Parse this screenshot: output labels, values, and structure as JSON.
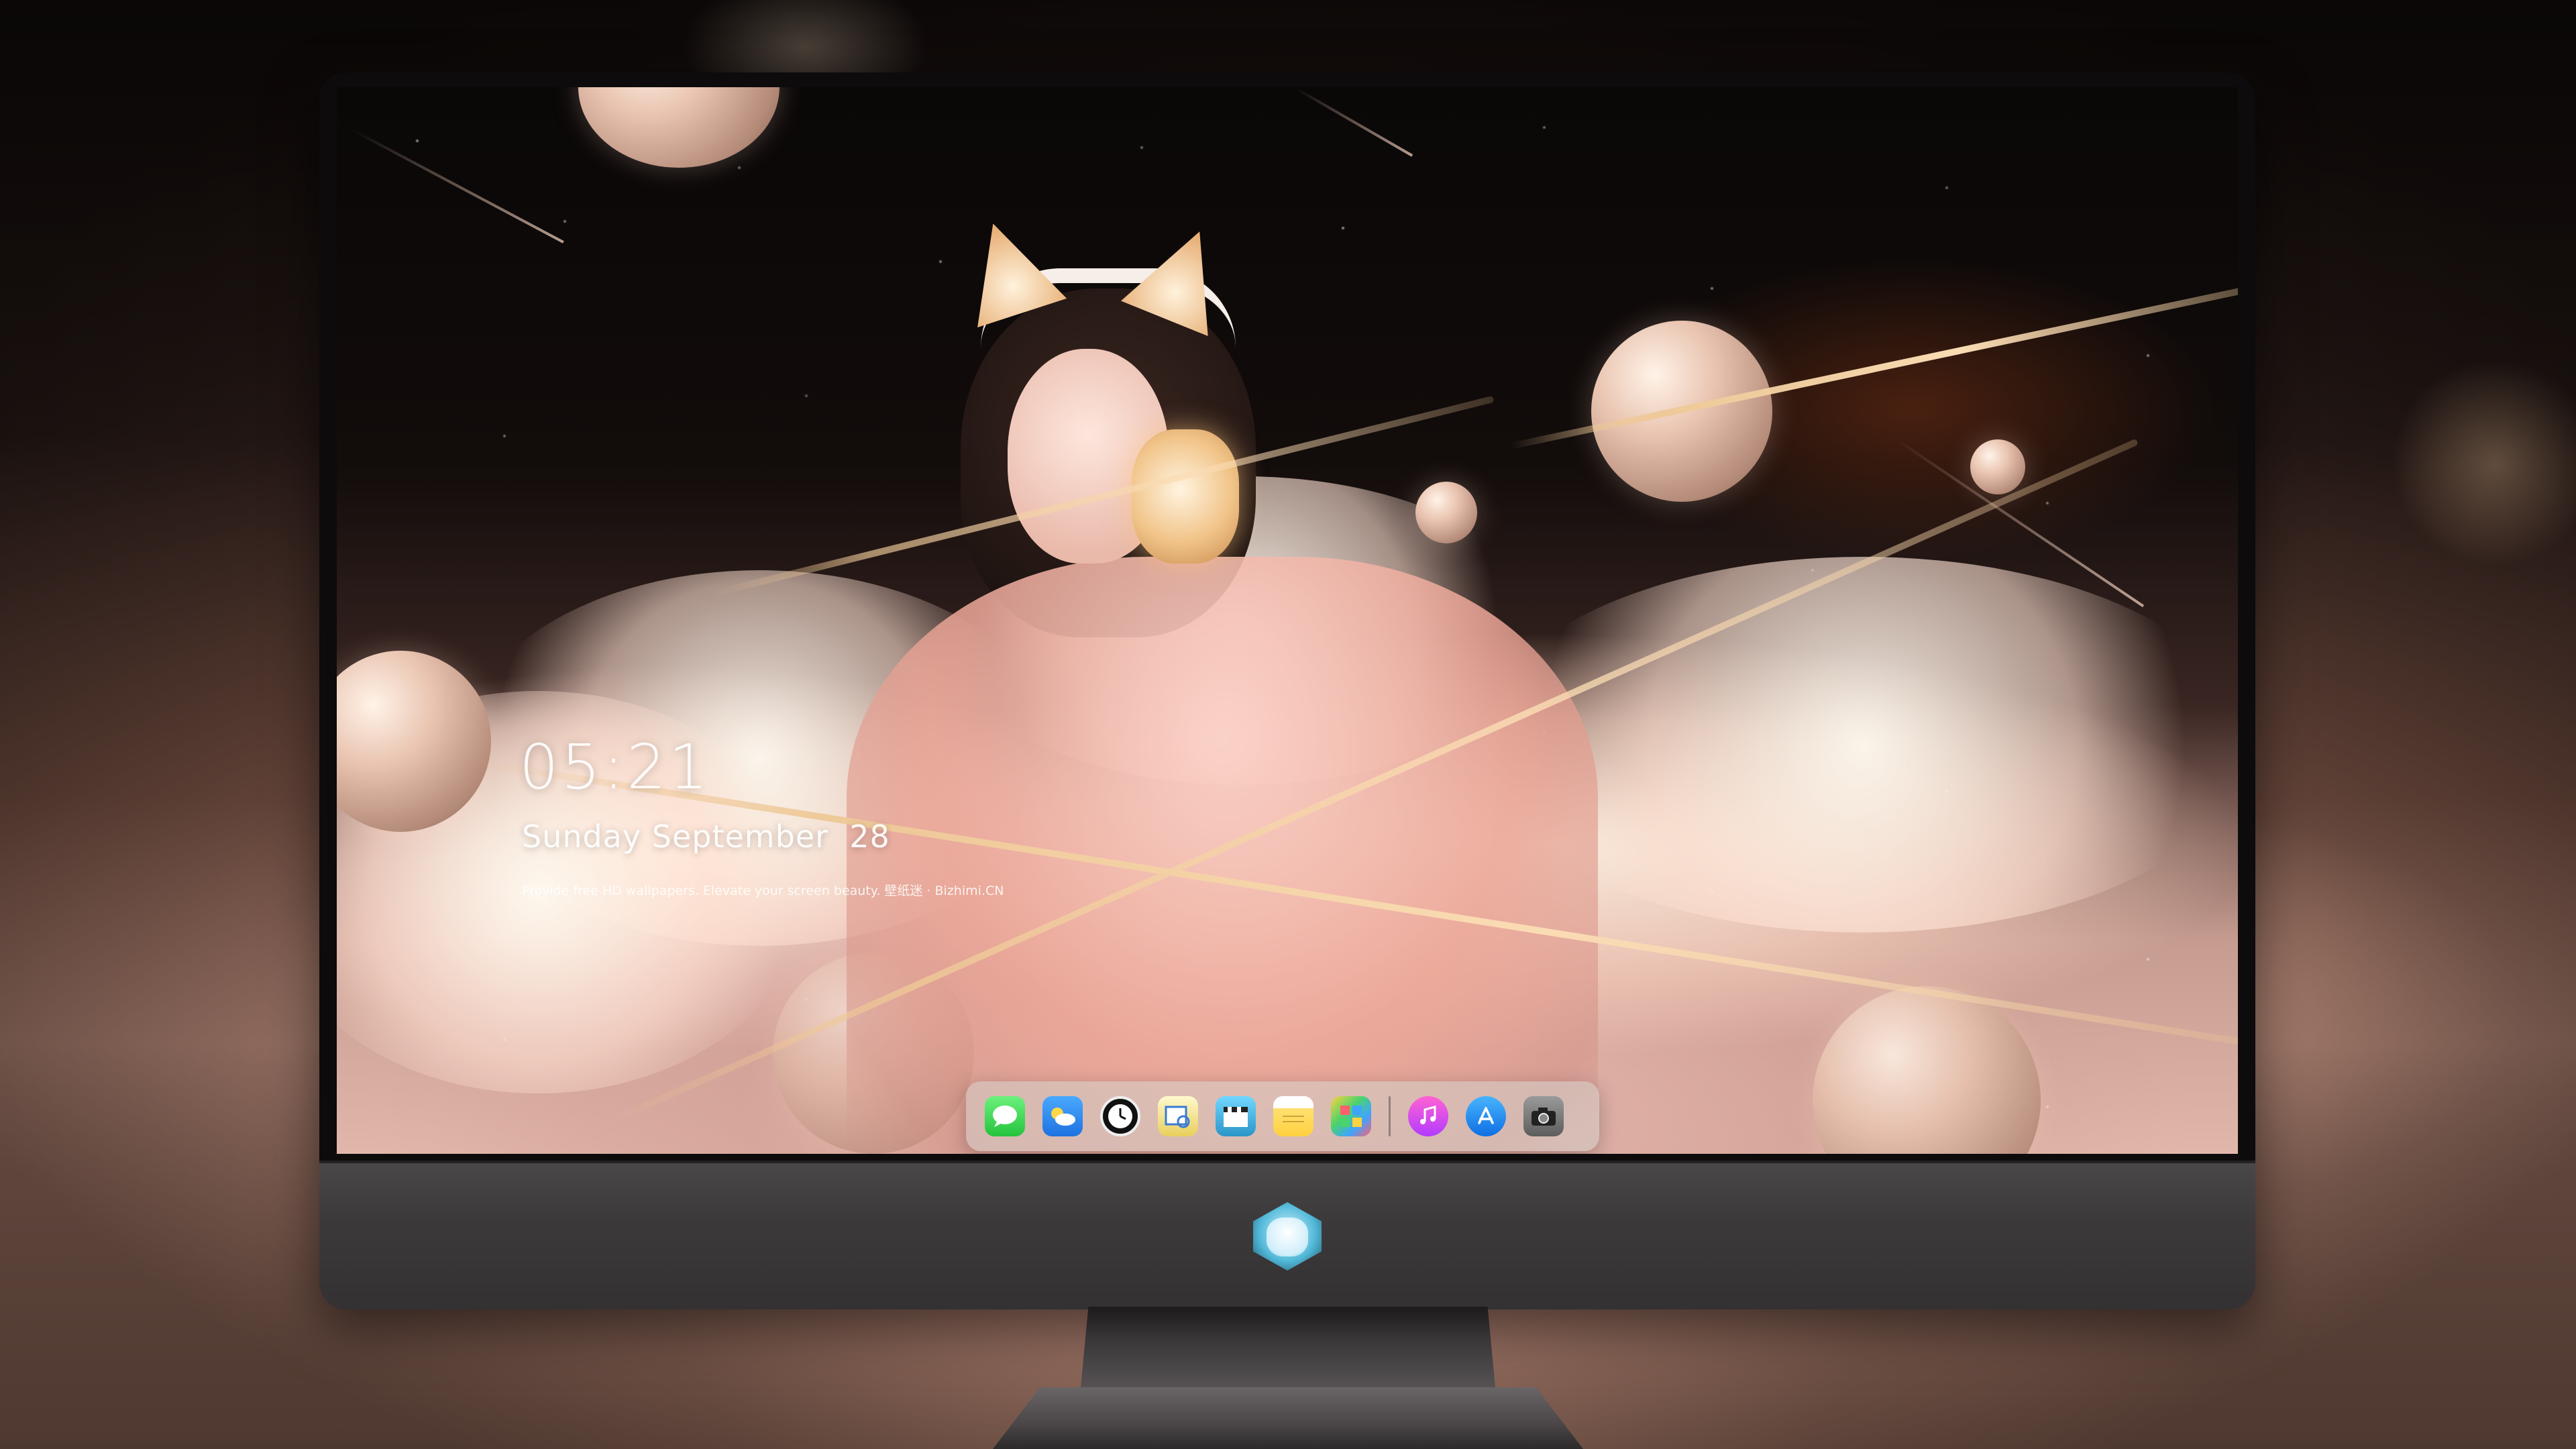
{
  "lock_screen": {
    "time": "05:21",
    "date": "Sunday September  28",
    "caption": "Provide free HD wallpapers. Elevate your screen beauty. 壁纸迷 · Bizhimi.CN"
  },
  "dock": {
    "apps": [
      {
        "name": "Messages",
        "icon": "messages-icon"
      },
      {
        "name": "Weather",
        "icon": "weather-icon"
      },
      {
        "name": "Clock",
        "icon": "clock-icon"
      },
      {
        "name": "Preview",
        "icon": "preview-icon"
      },
      {
        "name": "Claquette",
        "icon": "clapperboard-icon"
      },
      {
        "name": "Notes",
        "icon": "notes-icon"
      },
      {
        "name": "Photos",
        "icon": "photos-icon"
      },
      {
        "name": "Music",
        "icon": "music-icon"
      },
      {
        "name": "App Store",
        "icon": "app-store-icon"
      },
      {
        "name": "Camera",
        "icon": "camera-icon"
      }
    ]
  },
  "colors": {
    "screen_sky": "#0a0707",
    "cloud_glow": "#fff4e4",
    "chin": "#3c393b",
    "dock_bg": "#d2cdc8"
  }
}
